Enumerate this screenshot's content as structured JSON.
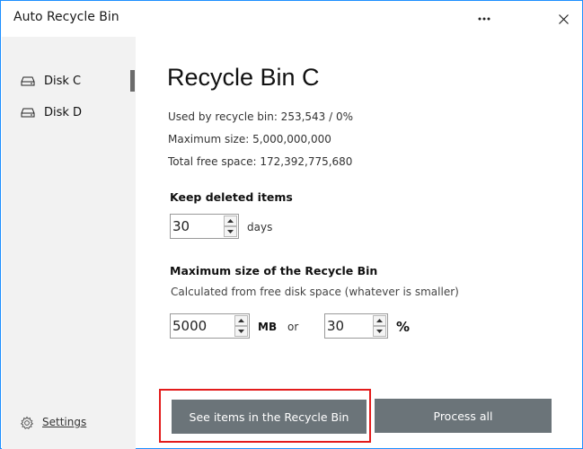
{
  "window": {
    "title": "Auto Recycle Bin",
    "accent_color": "#1e90ff"
  },
  "titlebar": {
    "more_icon": "ellipsis-icon",
    "close_icon": "close-icon"
  },
  "sidebar": {
    "items": [
      {
        "label": "Disk C",
        "icon": "disk-drive-icon",
        "selected": true
      },
      {
        "label": "Disk D",
        "icon": "disk-drive-icon",
        "selected": false
      }
    ],
    "settings_label": "Settings",
    "settings_icon": "gear-icon"
  },
  "main": {
    "heading": "Recycle Bin C",
    "used_text": "Used by recycle bin: 253,543 / 0%",
    "max_size_text": "Maximum size: 5,000,000,000",
    "free_space_text": "Total free space: 172,392,775,680",
    "keep": {
      "title": "Keep deleted items",
      "value": "30",
      "unit": "days"
    },
    "max": {
      "title": "Maximum size of the Recycle Bin",
      "subtitle": "Calculated from free disk space (whatever is smaller)",
      "mb_value": "5000",
      "mb_unit": "MB",
      "or_text": "or",
      "pct_value": "30",
      "pct_unit": "%"
    },
    "buttons": {
      "see_items": "See items in the Recycle Bin",
      "process_all": "Process all"
    },
    "button_color": "#6b7479",
    "highlight_color": "#e31b1b"
  }
}
